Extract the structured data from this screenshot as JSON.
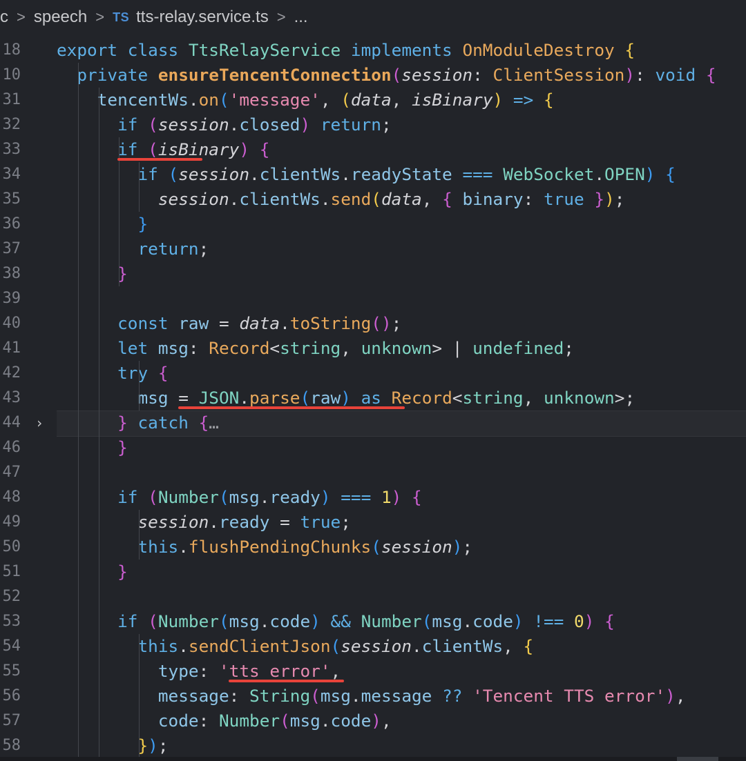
{
  "breadcrumb": {
    "items": [
      "rc",
      "speech",
      "tts-relay.service.ts",
      "..."
    ],
    "separator": ">",
    "file_badge": "TS"
  },
  "fold_icon": "chevron-right-icon",
  "colors": {
    "background": "#222429",
    "underline": "#e8433a",
    "keyword": "#5fb0e6",
    "string": "#e78ab0",
    "function": "#e9a95c"
  },
  "lines": [
    {
      "n": "18",
      "code": "export class TtsRelayService implements OnModuleDestroy {"
    },
    {
      "n": "10",
      "code": "  private ensureTencentConnection(session: ClientSession): void {"
    },
    {
      "n": "31",
      "code": "    tencentWs.on('message', (data, isBinary) => {"
    },
    {
      "n": "32",
      "code": "      if (session.closed) return;"
    },
    {
      "n": "33",
      "code": "      if (isBinary) {"
    },
    {
      "n": "34",
      "code": "        if (session.clientWs.readyState === WebSocket.OPEN) {"
    },
    {
      "n": "35",
      "code": "          session.clientWs.send(data, { binary: true });"
    },
    {
      "n": "36",
      "code": "        }"
    },
    {
      "n": "37",
      "code": "        return;"
    },
    {
      "n": "38",
      "code": "      }"
    },
    {
      "n": "39",
      "code": ""
    },
    {
      "n": "40",
      "code": "      const raw = data.toString();"
    },
    {
      "n": "41",
      "code": "      let msg: Record<string, unknown> | undefined;"
    },
    {
      "n": "42",
      "code": "      try {"
    },
    {
      "n": "43",
      "code": "        msg = JSON.parse(raw) as Record<string, unknown>;"
    },
    {
      "n": "44",
      "code": "      } catch {…"
    },
    {
      "n": "46",
      "code": "      }"
    },
    {
      "n": "47",
      "code": ""
    },
    {
      "n": "48",
      "code": "      if (Number(msg.ready) === 1) {"
    },
    {
      "n": "49",
      "code": "        session.ready = true;"
    },
    {
      "n": "50",
      "code": "        this.flushPendingChunks(session);"
    },
    {
      "n": "51",
      "code": "      }"
    },
    {
      "n": "52",
      "code": ""
    },
    {
      "n": "53",
      "code": "      if (Number(msg.code) && Number(msg.code) !== 0) {"
    },
    {
      "n": "54",
      "code": "        this.sendClientJson(session.clientWs, {"
    },
    {
      "n": "55",
      "code": "          type: 'tts_error',"
    },
    {
      "n": "56",
      "code": "          message: String(msg.message ?? 'Tencent TTS error'),"
    },
    {
      "n": "57",
      "code": "          code: Number(msg.code),"
    },
    {
      "n": "58",
      "code": "        });"
    }
  ]
}
